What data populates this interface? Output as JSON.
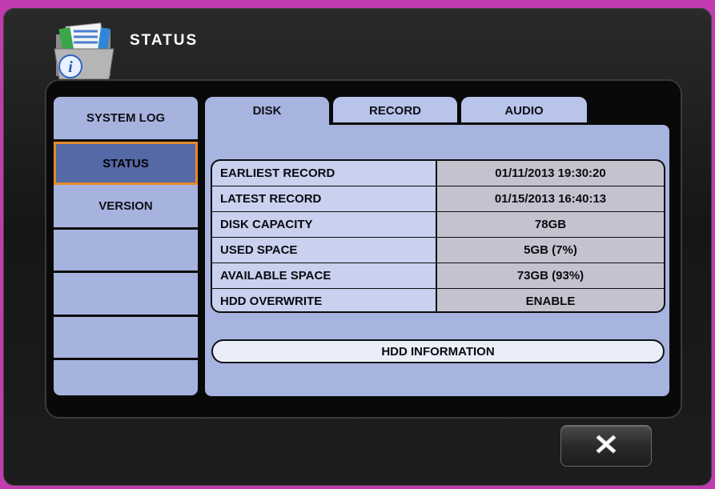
{
  "window": {
    "title": "STATUS",
    "title_icon": "info-folder-icon"
  },
  "sidebar": {
    "items": [
      {
        "label": "SYSTEM LOG"
      },
      {
        "label": "STATUS",
        "active": true
      },
      {
        "label": "VERSION"
      },
      {
        "label": ""
      },
      {
        "label": ""
      },
      {
        "label": ""
      },
      {
        "label": ""
      }
    ]
  },
  "tabs": [
    {
      "label": "DISK",
      "active": true
    },
    {
      "label": "RECORD"
    },
    {
      "label": "AUDIO"
    }
  ],
  "disk": {
    "rows": [
      {
        "label": "EARLIEST RECORD",
        "value": "01/11/2013 19:30:20"
      },
      {
        "label": "LATEST RECORD",
        "value": "01/15/2013 16:40:13"
      },
      {
        "label": "DISK CAPACITY",
        "value": "78GB"
      },
      {
        "label": "USED SPACE",
        "value": "5GB (7%)"
      },
      {
        "label": "AVAILABLE SPACE",
        "value": "73GB (93%)"
      },
      {
        "label": "HDD OVERWRITE",
        "value": "ENABLE"
      }
    ],
    "hdd_info_button": "HDD INFORMATION"
  },
  "close_button": {
    "icon": "close-x-icon"
  },
  "colors": {
    "background_accent": "#c23bb0",
    "panel": "#a7b4df",
    "active_sidebar": "#5569a6",
    "active_border": "#e58a2c"
  }
}
